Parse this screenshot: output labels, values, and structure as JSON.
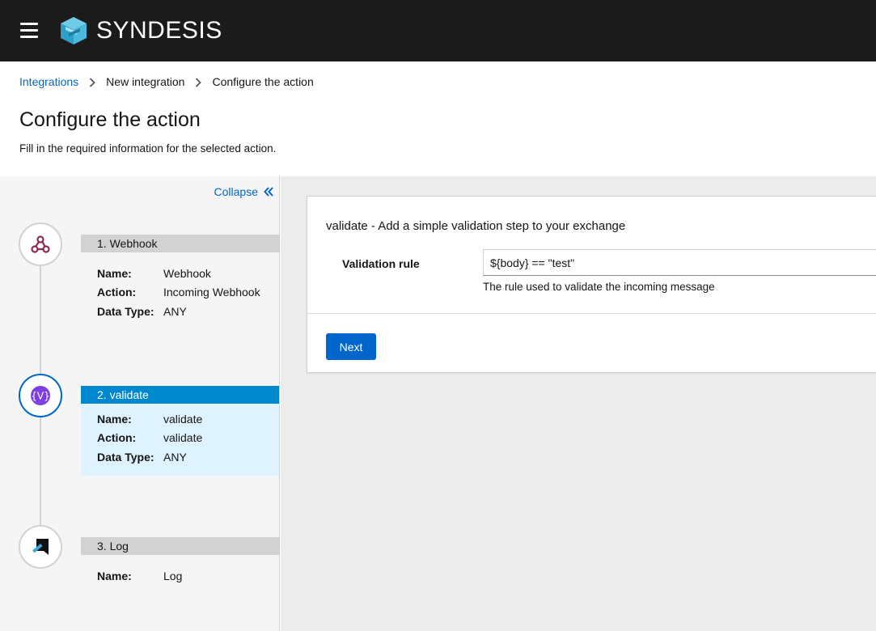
{
  "app": {
    "title": "SYNDESIS"
  },
  "breadcrumb": {
    "items": [
      "Integrations",
      "New integration",
      "Configure the action"
    ]
  },
  "page": {
    "title": "Configure the action",
    "description": "Fill in the required information for the selected action."
  },
  "sidebar": {
    "collapse_label": "Collapse",
    "steps": [
      {
        "header": "1. Webhook",
        "icon": "webhook-icon",
        "active": false,
        "fields": [
          {
            "key": "Name:",
            "value": "Webhook"
          },
          {
            "key": "Action:",
            "value": "Incoming Webhook"
          },
          {
            "key": "Data Type:",
            "value": "ANY"
          }
        ]
      },
      {
        "header": "2. validate",
        "icon": "validate-icon",
        "active": true,
        "fields": [
          {
            "key": "Name:",
            "value": "validate"
          },
          {
            "key": "Action:",
            "value": "validate"
          },
          {
            "key": "Data Type:",
            "value": "ANY"
          }
        ]
      },
      {
        "header": "3. Log",
        "icon": "log-icon",
        "active": false,
        "fields": [
          {
            "key": "Name:",
            "value": "Log"
          }
        ]
      }
    ]
  },
  "form": {
    "title": "validate - Add a simple validation step to your exchange",
    "field_label": "Validation rule",
    "field_value": "${body} == \"test\"",
    "field_help": "The rule used to validate the incoming message",
    "next_label": "Next"
  },
  "colors": {
    "topbar": "#1b1b1b",
    "link": "#0066cc",
    "active_step": "#0088ce",
    "active_step_bg": "#def3ff",
    "primary_button": "#0066cc"
  }
}
